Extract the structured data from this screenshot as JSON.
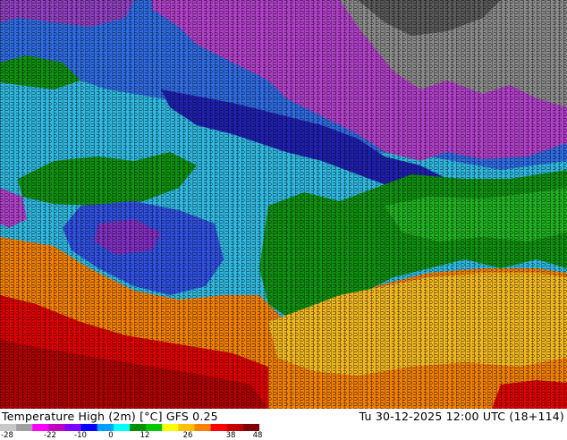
{
  "map": {
    "variable_label": "Temperature High (2m) [°C] GFS 0.25",
    "valid_time_label": "Tu 30-12-2025 12:00 UTC (18+114)",
    "units": "°C",
    "model": "GFS 0.25",
    "projection_look": "regional lat-lon, land areas coloured by temperature with dense number overlay"
  },
  "legend": {
    "ticks": [
      "-28",
      "-22",
      "-10",
      "0",
      "12",
      "26",
      "38",
      "48"
    ],
    "colors": [
      "#c8c8c8",
      "#a0a0a0",
      "#ff00ff",
      "#c000c0",
      "#8000ff",
      "#0000ff",
      "#00a0ff",
      "#00ffff",
      "#009000",
      "#00c800",
      "#ffff00",
      "#ffc000",
      "#ff8000",
      "#ff0000",
      "#c00000",
      "#800000"
    ]
  },
  "palette": {
    "gray": "#8a8a8a",
    "dark_gray": "#4a4a4a",
    "magenta": "#b040c8",
    "purple": "#9a30c0",
    "blue": "#2f6be0",
    "dark_blue": "#2020b0",
    "cyan": "#30c0e8",
    "green": "#109010",
    "bright_green": "#20c020",
    "yellow": "#f0c020",
    "orange": "#f08000",
    "red": "#e00000",
    "dark_red": "#a00000"
  }
}
